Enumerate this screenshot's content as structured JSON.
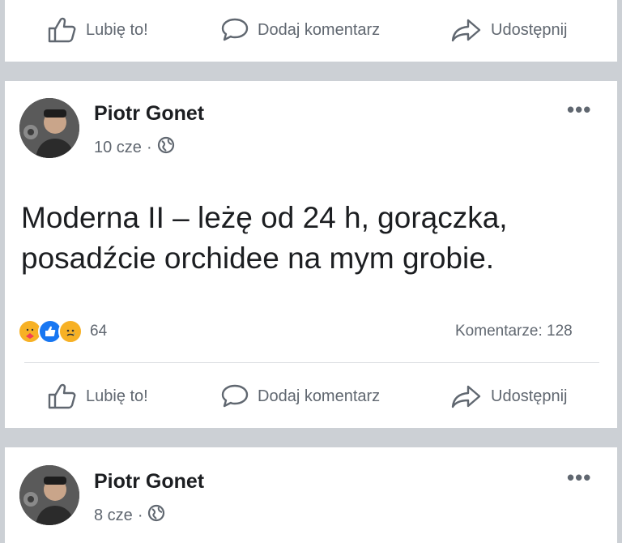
{
  "actions": {
    "like_label": "Lubię to!",
    "comment_label": "Dodaj komentarz",
    "share_label": "Udostępnij"
  },
  "posts": [
    {
      "author": "Piotr Gonet",
      "time": "10 cze",
      "text_line1": "Moderna II – leżę od 24 h, gorączka,",
      "text_line2": "posadźcie orchidee na mym grobie.",
      "reaction_count": "64",
      "comments": "Komentarze: 128"
    },
    {
      "author": "Piotr Gonet",
      "time": "8 cze"
    }
  ],
  "icons": {
    "like": "thumbs-up-icon",
    "comment": "speech-bubble-icon",
    "share": "share-arrow-icon",
    "audience": "globe-icon",
    "more": "more-dots-icon",
    "reactions": [
      "care-reaction-icon",
      "like-reaction-icon",
      "sad-reaction-icon"
    ]
  },
  "colors": {
    "background": "#ccd0d5",
    "card": "#ffffff",
    "secondary_text": "#606770",
    "like_blue": "#1877f2"
  }
}
